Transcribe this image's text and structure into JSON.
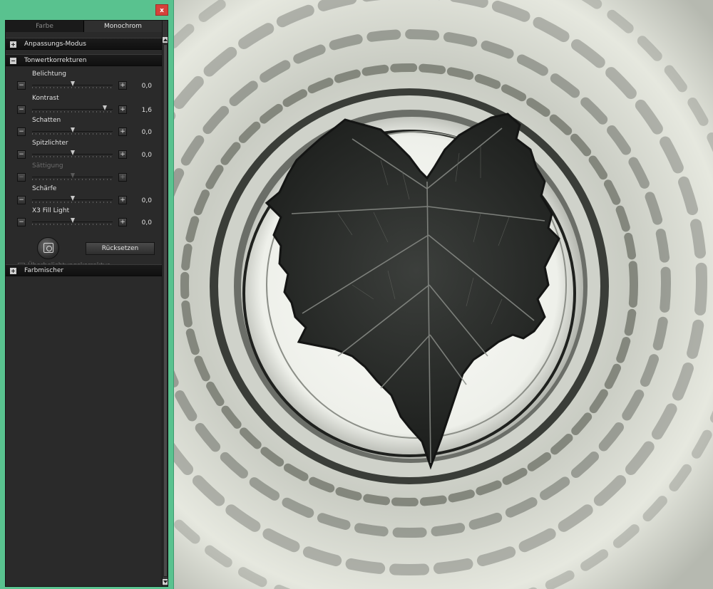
{
  "window": {
    "close_label": "x"
  },
  "tabs": [
    {
      "label": "Farbe",
      "active": false
    },
    {
      "label": "Monochrom",
      "active": true
    }
  ],
  "sections": {
    "adjust_mode": {
      "label": "Anpassungs-Modus",
      "expanded": false
    },
    "tone": {
      "label": "Tonwertkorrekturen",
      "expanded": true
    },
    "mixer": {
      "label": "Farbmischer",
      "expanded": false
    }
  },
  "sliders": [
    {
      "label": "Belichtung",
      "value_text": "0,0",
      "position": 0.5,
      "enabled": true
    },
    {
      "label": "Kontrast",
      "value_text": "1,6",
      "position": 0.9,
      "enabled": true
    },
    {
      "label": "Schatten",
      "value_text": "0,0",
      "position": 0.5,
      "enabled": true
    },
    {
      "label": "Spitzlichter",
      "value_text": "0,0",
      "position": 0.5,
      "enabled": true
    },
    {
      "label": "Sättigung",
      "value_text": "",
      "position": 0.5,
      "enabled": false
    },
    {
      "label": "Schärfe",
      "value_text": "0,0",
      "position": 0.5,
      "enabled": true
    },
    {
      "label": "X3 Fill Light",
      "value_text": "0,0",
      "position": 0.5,
      "enabled": true
    }
  ],
  "buttons": {
    "minus": "−",
    "plus": "+",
    "expand_plus": "+",
    "collapse_minus": "−",
    "reset": "Rücksetzen",
    "auto_icon": "auto-adjust-icon"
  },
  "checkbox": {
    "label": "Überbelichtungskorrektur",
    "checked": false,
    "enabled": false
  },
  "colors": {
    "window_frame": "#59c28f",
    "close_button": "#d6423a",
    "panel_bg": "#2a2a2a"
  }
}
